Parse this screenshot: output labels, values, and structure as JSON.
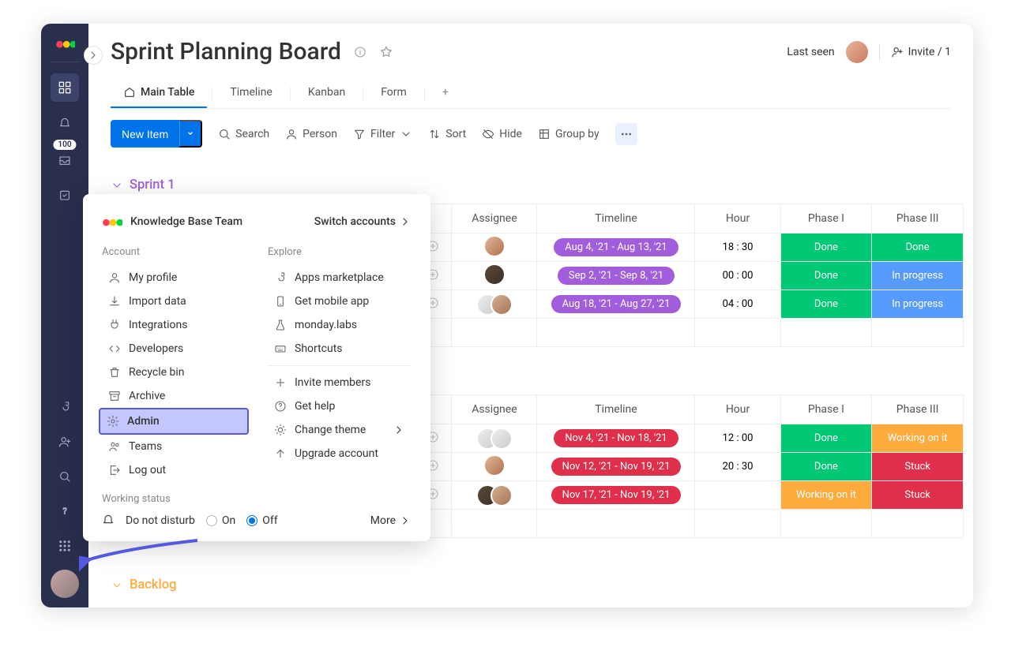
{
  "header": {
    "title": "Sprint Planning Board",
    "last_seen": "Last seen",
    "invite": "Invite / 1"
  },
  "tabs": {
    "main": "Main Table",
    "timeline": "Timeline",
    "kanban": "Kanban",
    "form": "Form"
  },
  "toolbar": {
    "new_item": "New Item",
    "search": "Search",
    "person": "Person",
    "filter": "Filter",
    "sort": "Sort",
    "hide": "Hide",
    "group_by": "Group by"
  },
  "rail": {
    "inbox_badge": "100"
  },
  "columns": {
    "assignee": "Assignee",
    "timeline": "Timeline",
    "hour": "Hour",
    "phase1": "Phase I",
    "phase3": "Phase III"
  },
  "groups": {
    "sprint1": {
      "title": "Sprint 1",
      "rows": [
        {
          "timeline": "Aug 4, '21 - Aug 13, '21",
          "hour": "18 : 30",
          "phase1": "Done",
          "phase3": "Done"
        },
        {
          "timeline": "Sep 2, '21 - Sep 8, '21",
          "hour": "00 : 00",
          "phase1": "Done",
          "phase3": "In progress"
        },
        {
          "timeline": "Aug 18, '21 - Aug 27, '21",
          "hour": "04 : 00",
          "phase1": "Done",
          "phase3": "In progress"
        }
      ]
    },
    "sprint2": {
      "rows": [
        {
          "timeline": "Nov 4, '21 - Nov 18, '21",
          "hour": "12 : 00",
          "phase1": "Done",
          "phase3": "Working on it"
        },
        {
          "timeline": "Nov 12, '21 - Nov 19, '21",
          "hour": "20 : 30",
          "phase1": "Done",
          "phase3": "Stuck"
        },
        {
          "timeline": "Nov 17, '21 - Nov 19, '21",
          "hour": "",
          "phase1": "Working on it",
          "phase3": "Stuck"
        }
      ]
    },
    "backlog": {
      "title": "Backlog"
    }
  },
  "popup": {
    "team": "Knowledge Base Team",
    "switch": "Switch accounts",
    "account_section": "Account",
    "explore_section": "Explore",
    "account": {
      "profile": "My profile",
      "import": "Import data",
      "integrations": "Integrations",
      "developers": "Developers",
      "recycle": "Recycle bin",
      "archive": "Archive",
      "admin": "Admin",
      "teams": "Teams",
      "logout": "Log out"
    },
    "explore": {
      "apps": "Apps marketplace",
      "mobile": "Get mobile app",
      "labs": "monday.labs",
      "shortcuts": "Shortcuts",
      "invite": "Invite members",
      "help": "Get help",
      "theme": "Change theme",
      "upgrade": "Upgrade account"
    },
    "working_status": "Working status",
    "dnd": "Do not disturb",
    "on": "On",
    "off": "Off",
    "more": "More"
  }
}
